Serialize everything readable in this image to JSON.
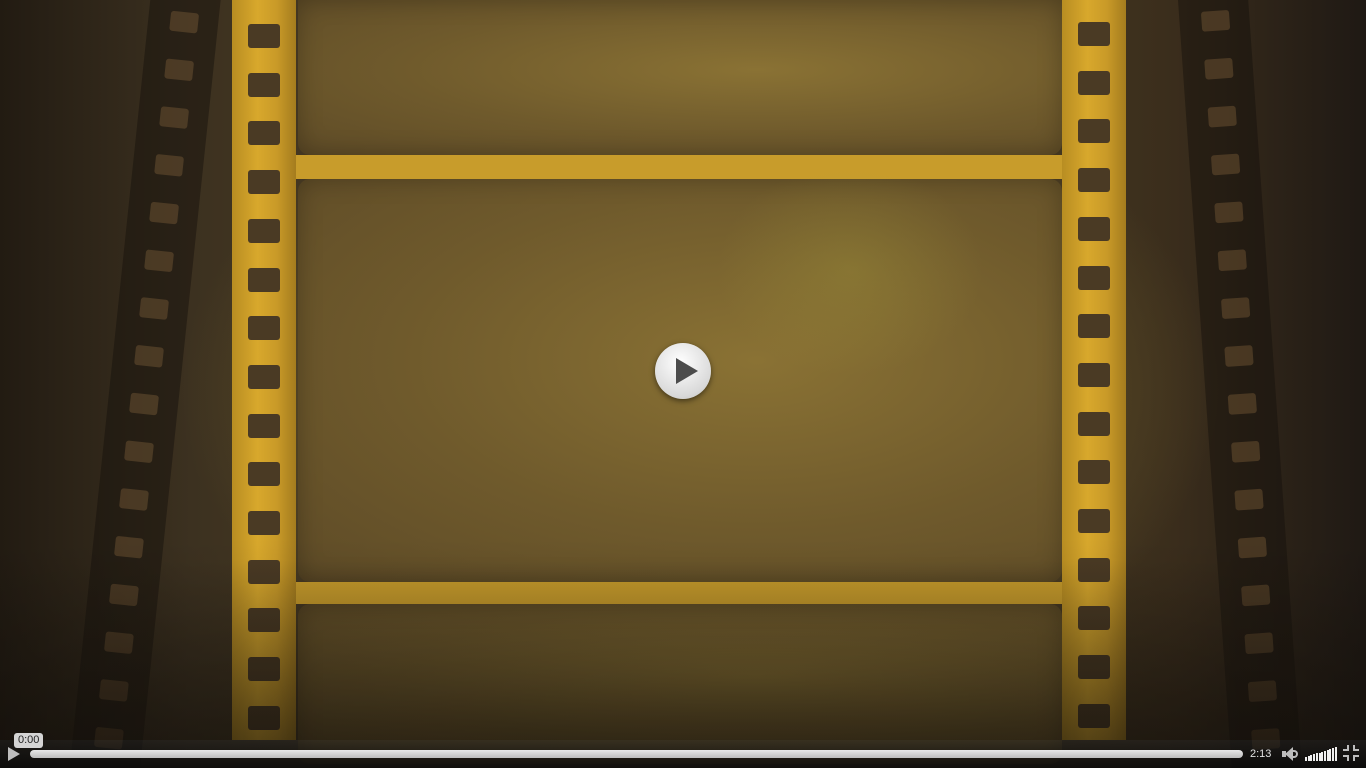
{
  "player": {
    "current_time": "0:00",
    "duration": "2:13",
    "progress_fraction": 0,
    "volume_fraction": 1.0,
    "state": "paused"
  },
  "icons": {
    "big_play": "play-icon",
    "control_play": "play-icon",
    "volume": "speaker-icon",
    "volume_level": "volume-bars-icon",
    "fullscreen": "exit-fullscreen-icon"
  },
  "colors": {
    "film_gold": "#c89c2b",
    "frame_brown": "#6f5a2c",
    "control_text": "#e0e0e0"
  }
}
